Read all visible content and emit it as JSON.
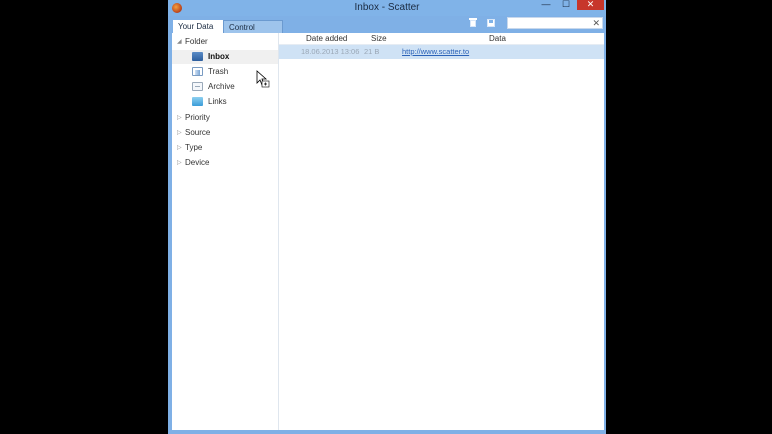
{
  "window": {
    "title": "Inbox - Scatter",
    "minimize_glyph": "—",
    "maximize_glyph": "☐",
    "close_glyph": "✕",
    "app_icon": "scatter-app-icon"
  },
  "tabs": [
    {
      "label": "Your Data",
      "active": true
    },
    {
      "label": "Control Panel",
      "active": false
    }
  ],
  "toolbar": {
    "icons": [
      "trash-icon",
      "save-icon"
    ],
    "search_value": "",
    "search_clear": "✕"
  },
  "sidebar": {
    "folder": {
      "label": "Folder",
      "expanded": true,
      "arrow": "◢",
      "children": [
        {
          "label": "Inbox",
          "icon": "inbox-icon",
          "selected": true
        },
        {
          "label": "Trash",
          "icon": "trash-icon",
          "selected": false
        },
        {
          "label": "Archive",
          "icon": "archive-icon",
          "selected": false
        },
        {
          "label": "Links",
          "icon": "links-folder-icon",
          "selected": false
        }
      ]
    },
    "groups": [
      {
        "label": "Priority",
        "arrow": "▷"
      },
      {
        "label": "Source",
        "arrow": "▷"
      },
      {
        "label": "Type",
        "arrow": "▷"
      },
      {
        "label": "Device",
        "arrow": "▷"
      }
    ]
  },
  "table": {
    "columns": [
      "Date added",
      "Size",
      "Data"
    ],
    "rows": [
      {
        "date_added": "18.06.2013 13:06",
        "size": "21 B",
        "data": "http://www.scatter.to"
      }
    ]
  },
  "colors": {
    "titlebar": "#80b3e8",
    "close_button": "#c7362b",
    "selected_row": "#cfe2f5",
    "link": "#2c63b8"
  }
}
